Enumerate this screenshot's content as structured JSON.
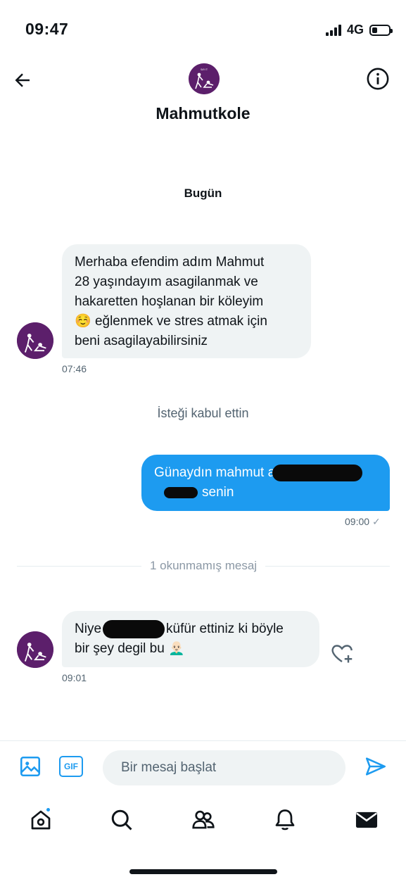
{
  "status": {
    "time": "09:47",
    "network": "4G"
  },
  "header": {
    "name": "Mahmutkole",
    "avatar_label": "SAY IT · SAY · MY MISTRESS"
  },
  "day_label": "Bugün",
  "messages": {
    "m1": {
      "lines": [
        "Merhaba efendim adım Mahmut",
        "28 yaşındayım asagilanmak ve",
        "hakaretten hoşlanan bir köleyim",
        "eğlenmek ve stres atmak için",
        "beni asagilayabilirsiniz"
      ],
      "emoji": "☺️",
      "time": "07:46"
    },
    "request_note": "İsteği kabul ettin",
    "m2": {
      "line1": "Günaydın mahmut a",
      "line2": "senin",
      "time": "09:00",
      "check": "✓"
    },
    "unread_label": "1 okunmamış mesaj",
    "m3": {
      "line1_pre": "Niye",
      "line1_post": "küfür ettiniz ki böyle",
      "line2": "bir şey degil bu",
      "emoji": "👨🏻‍🦲",
      "time": "09:01"
    }
  },
  "composer": {
    "placeholder": "Bir mesaj başlat",
    "gif_label": "GIF"
  },
  "colors": {
    "accent": "#1d9bf0",
    "bubble_in": "#eff3f4",
    "avatar_bg": "#5c1f6b"
  }
}
